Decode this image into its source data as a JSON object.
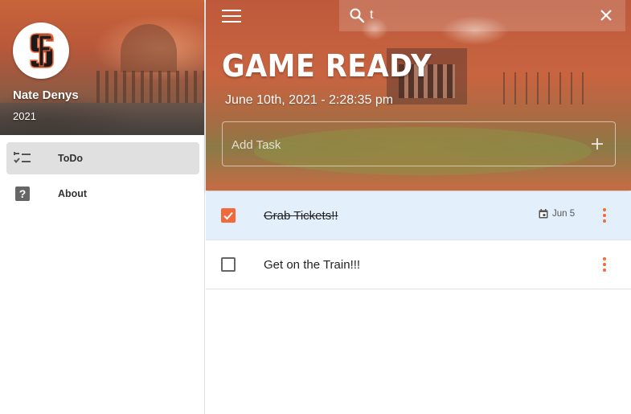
{
  "sidebar": {
    "user": {
      "name": "Nate Denys",
      "year": "2021",
      "avatar_icon": "sf-giants-logo"
    },
    "items": [
      {
        "label": "ToDo",
        "icon": "checklist-icon",
        "active": true
      },
      {
        "label": "About",
        "icon": "help-icon",
        "active": false
      }
    ]
  },
  "header": {
    "title": "GAME READY",
    "datetime": "June 10th, 2021 - 2:28:35 pm",
    "search": {
      "value": "t"
    },
    "add_task": {
      "placeholder": "Add Task"
    }
  },
  "tasks": [
    {
      "title": "Grab Tickets!!",
      "done": true,
      "due": "Jun 5"
    },
    {
      "title": "Get on the Train!!!",
      "done": false,
      "due": ""
    }
  ],
  "colors": {
    "accent": "#f26a3c",
    "done_row": "#e3f0fb",
    "active_nav": "#e0e0e0"
  }
}
